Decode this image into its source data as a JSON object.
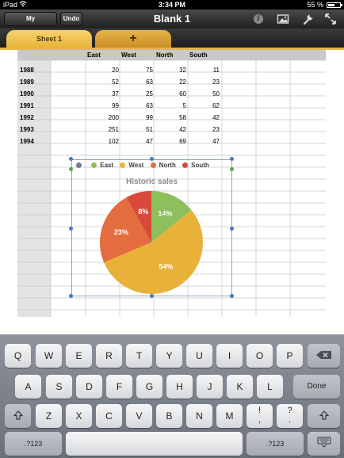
{
  "status_bar": {
    "carrier": "iPad",
    "time": "3:34 PM",
    "battery": "55 %",
    "wifi_icon": "wifi-icon",
    "battery_icon": "battery-icon"
  },
  "toolbar": {
    "my_spreadsheets": "My Spreadsheets",
    "undo": "Undo",
    "title": "Blank 1",
    "icons": [
      "info-icon",
      "media-icon",
      "tools-icon",
      "fullscreen-icon"
    ]
  },
  "tabs": {
    "sheet_label": "Sheet 1",
    "add_label": "+"
  },
  "table": {
    "headers": [
      "East",
      "West",
      "North",
      "South"
    ],
    "rows": [
      {
        "year": "1988",
        "values": [
          "20",
          "75",
          "32",
          "11"
        ]
      },
      {
        "year": "1989",
        "values": [
          "52",
          "63",
          "22",
          "23"
        ]
      },
      {
        "year": "1990",
        "values": [
          "37",
          "25",
          "60",
          "50"
        ]
      },
      {
        "year": "1991",
        "values": [
          "99",
          "63",
          "5",
          "62"
        ]
      },
      {
        "year": "1992",
        "values": [
          "200",
          "99",
          "58",
          "42"
        ]
      },
      {
        "year": "1993",
        "values": [
          "251",
          "51",
          "42",
          "23"
        ]
      },
      {
        "year": "1994",
        "values": [
          "102",
          "47",
          "69",
          "47"
        ]
      }
    ]
  },
  "chart_data": {
    "type": "pie",
    "title": "Historic sales",
    "categories": [
      "East",
      "West",
      "North",
      "South"
    ],
    "values": [
      14,
      54,
      23,
      8
    ],
    "labels": [
      "14%",
      "54%",
      "23%",
      "8%"
    ],
    "colors": [
      "#8dbf5c",
      "#e8b23a",
      "#e36d3e",
      "#d9493a"
    ],
    "legend_dot_colors": [
      "#6f7d8c",
      "#8dbf5c",
      "#e8b23a",
      "#e36d3e",
      "#d9493a"
    ],
    "legend": "top"
  },
  "keyboard": {
    "row1": [
      "Q",
      "W",
      "E",
      "R",
      "T",
      "Y",
      "U",
      "I",
      "O",
      "P"
    ],
    "row2": [
      "A",
      "S",
      "D",
      "F",
      "G",
      "H",
      "J",
      "K",
      "L"
    ],
    "row3": [
      "Z",
      "X",
      "C",
      "V",
      "B",
      "N",
      "M"
    ],
    "done": "Done",
    "punct1": "!\n,",
    "punct2": "?\n.",
    "num_label": ".?123",
    "icons": [
      "backspace-icon",
      "shift-icon",
      "keyboard-hide-icon"
    ]
  }
}
